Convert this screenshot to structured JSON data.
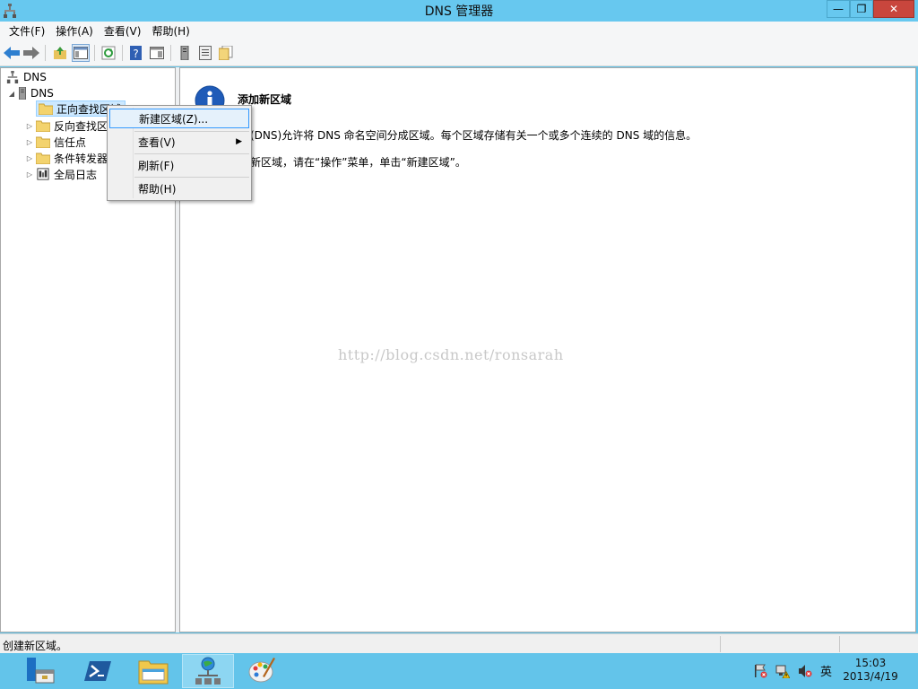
{
  "window": {
    "title": "DNS 管理器"
  },
  "menubar": [
    "文件(F)",
    "操作(A)",
    "查看(V)",
    "帮助(H)"
  ],
  "tree": {
    "root": "DNS",
    "server": "DNS",
    "items": [
      "正向查找区域",
      "反向查找区域",
      "信任点",
      "条件转发器",
      "全局日志"
    ]
  },
  "context_menu": {
    "items": [
      "新建区域(Z)...",
      "查看(V)",
      "刷新(F)",
      "帮助(H)"
    ]
  },
  "content": {
    "heading": "添加新区域",
    "line1": "(DNS)允许将 DNS 命名空间分成区域。每个区域存储有关一个或多个连续的 DNS 域的信息。",
    "line2": "新区域，请在“操作”菜单，单击“新建区域”。",
    "watermark": "http://blog.csdn.net/ronsarah"
  },
  "statusbar": {
    "text": "创建新区域。"
  },
  "tray": {
    "ime": "英"
  },
  "clock": {
    "time": "15:03",
    "date": "2013/4/19"
  },
  "icons": [
    "dns-app-icon",
    "back-icon",
    "forward-icon",
    "up-folder-icon",
    "show-console-tree-icon",
    "refresh-icon",
    "help-icon",
    "action-pane-icon",
    "server-icon",
    "list-icon",
    "properties-icon",
    "info-icon",
    "folder-icon",
    "log-icon",
    "server-manager-icon",
    "powershell-icon",
    "file-explorer-icon",
    "dns-manager-icon",
    "paint-icon",
    "flag-icon",
    "network-icon",
    "volume-icon"
  ],
  "colors": {
    "titlebar": "#67c8ef",
    "taskbar": "#63c4ea",
    "close": "#c9463d",
    "selection": "#cce8ff",
    "highlight_border": "#3399ff"
  }
}
